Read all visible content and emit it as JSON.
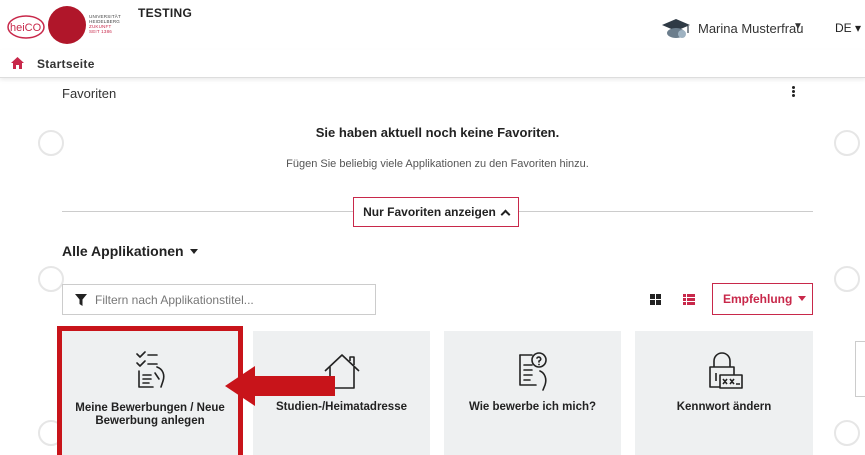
{
  "header": {
    "env_label": "TESTING",
    "user_name": "Marina Musterfrau",
    "language": "DE",
    "university_lines": [
      "UNIVERSITÄT",
      "HEIDELBERG",
      "ZUKUNFT",
      "SEIT 1386"
    ],
    "logo_text": "heiCO"
  },
  "nav": {
    "home_label": "Startseite"
  },
  "favorites": {
    "title": "Favoriten",
    "empty_title": "Sie haben aktuell noch keine Favoriten.",
    "empty_hint": "Fügen Sie beliebig viele Applikationen zu den Favoriten hinzu.",
    "toggle_label": "Nur Favoriten anzeigen"
  },
  "apps": {
    "title": "Alle Applikationen",
    "filter_placeholder": "Filtern nach Applikationstitel...",
    "sort_label": "Empfehlung",
    "tiles": [
      {
        "label": "Meine Bewerbungen / Neue Bewerbung anlegen",
        "icon": "application-list-icon"
      },
      {
        "label": "Studien-/Heimatadresse",
        "icon": "house-icon"
      },
      {
        "label": "Wie bewerbe ich mich?",
        "icon": "help-document-icon"
      },
      {
        "label": "Kennwort ändern",
        "icon": "password-lock-icon"
      }
    ]
  },
  "colors": {
    "accent": "#c8284a",
    "highlight": "#c8141a",
    "tile_bg": "#eef0f1"
  }
}
